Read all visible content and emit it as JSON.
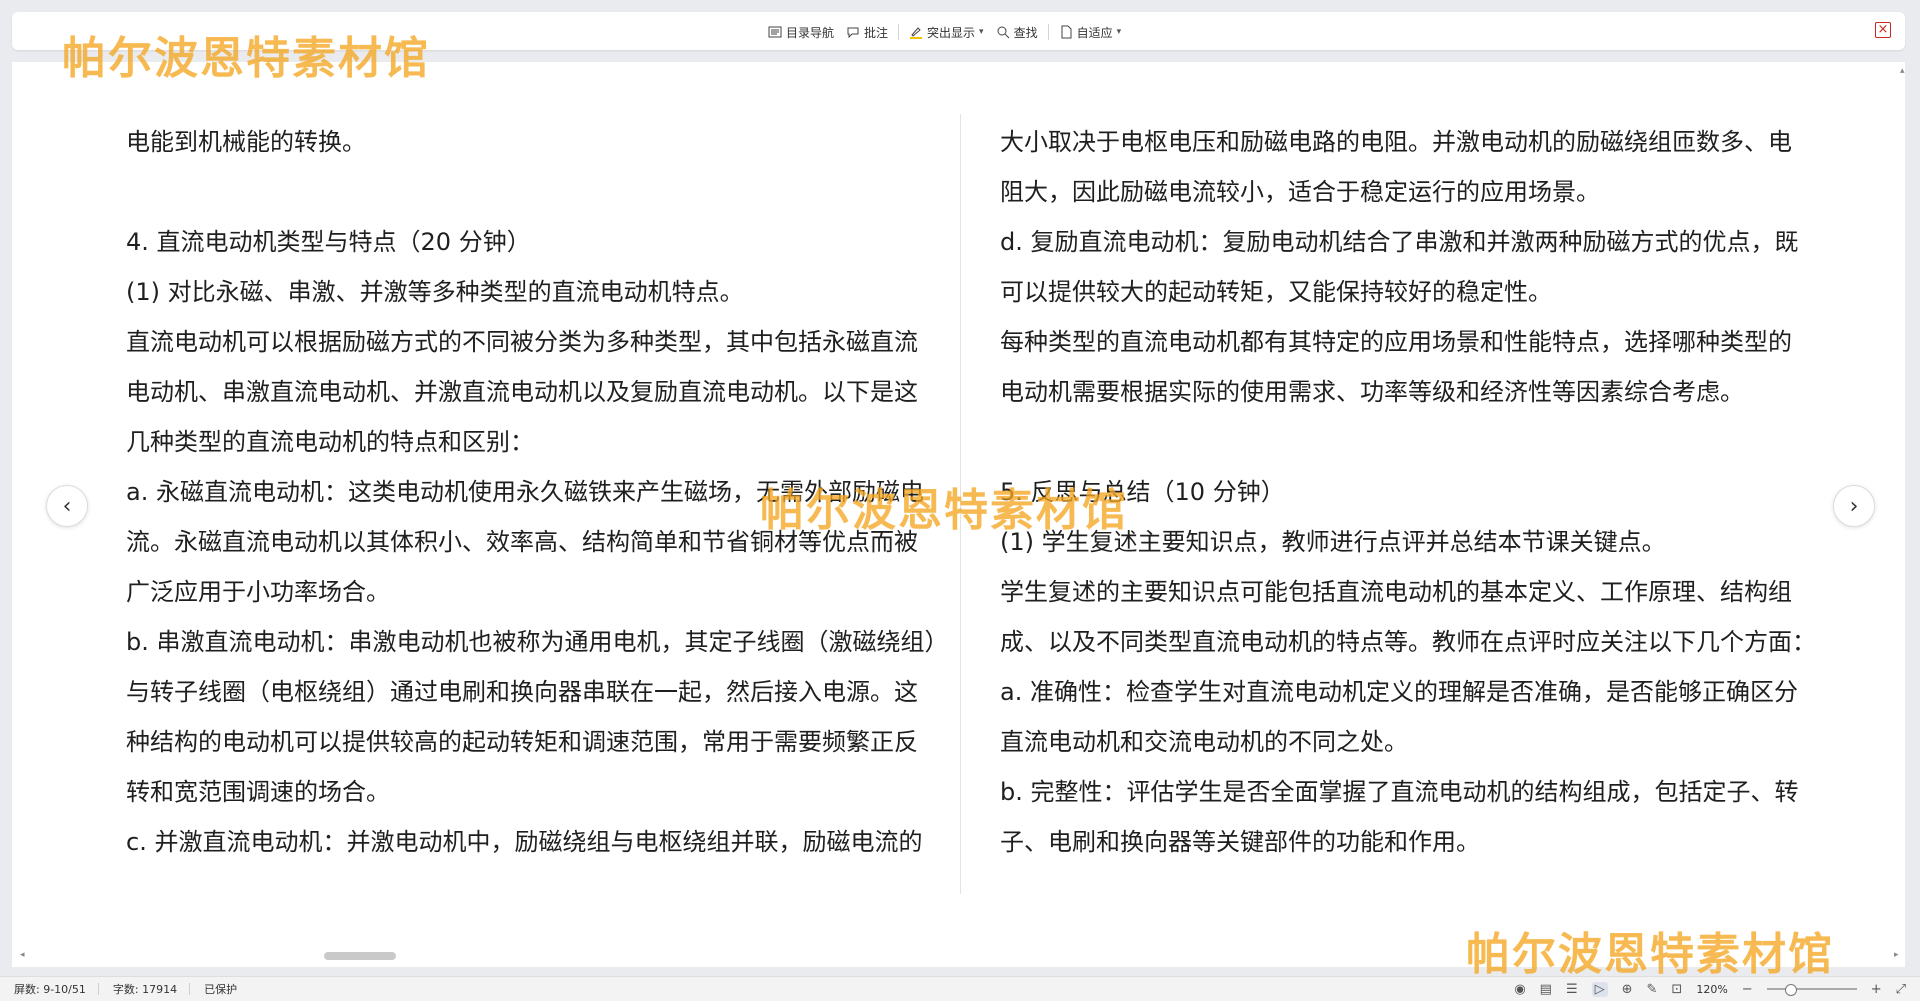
{
  "toolbar": {
    "items": [
      {
        "icon": "toc-icon",
        "label": "目录导航"
      },
      {
        "icon": "comment-icon",
        "label": "批注"
      },
      {
        "icon": "highlight-icon",
        "label": "突出显示"
      },
      {
        "icon": "search-icon",
        "label": "查找"
      },
      {
        "icon": "fit-icon",
        "label": "自适应"
      }
    ]
  },
  "watermark": "帕尔波恩特素材馆",
  "document": {
    "left_column": [
      "电能到机械能的转换。",
      "",
      "4. 直流电动机类型与特点（20 分钟）",
      "(1) 对比永磁、串激、并激等多种类型的直流电动机特点。",
      "直流电动机可以根据励磁方式的不同被分类为多种类型，其中包括永磁直流",
      "电动机、串激直流电动机、并激直流电动机以及复励直流电动机。以下是这",
      "几种类型的直流电动机的特点和区别：",
      "a. 永磁直流电动机：这类电动机使用永久磁铁来产生磁场，无需外部励磁电",
      "流。永磁直流电动机以其体积小、效率高、结构简单和节省铜材等优点而被",
      "广泛应用于小功率场合。",
      "b. 串激直流电动机：串激电动机也被称为通用电机，其定子线圈（激磁绕组）",
      "与转子线圈（电枢绕组）通过电刷和换向器串联在一起，然后接入电源。这",
      "种结构的电动机可以提供较高的起动转矩和调速范围，常用于需要频繁正反",
      "转和宽范围调速的场合。",
      "c. 并激直流电动机：并激电动机中，励磁绕组与电枢绕组并联，励磁电流的"
    ],
    "right_column": [
      "大小取决于电枢电压和励磁电路的电阻。并激电动机的励磁绕组匝数多、电",
      "阻大，因此励磁电流较小，适合于稳定运行的应用场景。",
      "d. 复励直流电动机：复励电动机结合了串激和并激两种励磁方式的优点，既",
      "可以提供较大的起动转矩，又能保持较好的稳定性。",
      "每种类型的直流电动机都有其特定的应用场景和性能特点，选择哪种类型的",
      "电动机需要根据实际的使用需求、功率等级和经济性等因素综合考虑。",
      "",
      "5. 反思与总结（10 分钟）",
      "(1) 学生复述主要知识点，教师进行点评并总结本节课关键点。",
      "学生复述的主要知识点可能包括直流电动机的基本定义、工作原理、结构组",
      "成、以及不同类型直流电动机的特点等。教师在点评时应关注以下几个方面：",
      "a. 准确性：检查学生对直流电动机定义的理解是否准确，是否能够正确区分",
      "直流电动机和交流电动机的不同之处。",
      "b. 完整性：评估学生是否全面掌握了直流电动机的结构组成，包括定子、转",
      "子、电刷和换向器等关键部件的功能和作用。"
    ]
  },
  "status": {
    "screen": "屏数: 9-10/51",
    "words": "字数: 17914",
    "protected": "已保护",
    "zoom": "120%",
    "zoom_minus": "−",
    "zoom_plus": "+"
  },
  "colors": {
    "watermark": "#f5a623",
    "close": "#c42b1c",
    "background": "#e9ebef"
  }
}
